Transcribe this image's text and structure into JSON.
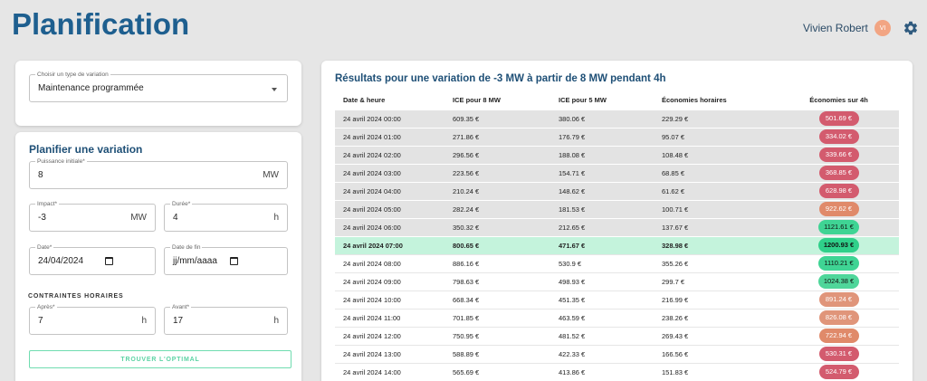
{
  "header": {
    "title": "Planification",
    "user_name": "Vivien Robert",
    "avatar_initials": "VI"
  },
  "variation_type": {
    "label": "Choisir un type de variation",
    "value": "Maintenance programmée"
  },
  "plan": {
    "title": "Planifier une variation",
    "puissance": {
      "label": "Puissance initiale*",
      "value": "8",
      "unit": "MW"
    },
    "impact": {
      "label": "Impact*",
      "value": "-3",
      "unit": "MW"
    },
    "duree": {
      "label": "Durée*",
      "value": "4",
      "unit": "h"
    },
    "date": {
      "label": "Date*",
      "value": "24/04/2024"
    },
    "date_fin": {
      "label": "Date de fin",
      "value": "jj/mm/aaaa"
    },
    "constraints_title": "CONTRAINTES HORAIRES",
    "apres": {
      "label": "Après*",
      "value": "7",
      "unit": "h"
    },
    "avant": {
      "label": "Avant*",
      "value": "17",
      "unit": "h"
    },
    "button_label": "TROUVER L'OPTIMAL"
  },
  "results": {
    "title": "Résultats pour une variation de -3 MW à partir de 8 MW pendant 4h",
    "columns": [
      "Date & heure",
      "ICE pour 8 MW",
      "ICE pour 5 MW",
      "Économies horaires",
      "Économies sur 4h"
    ],
    "rows": [
      {
        "date": "24 avril 2024 00:00",
        "ice8": "609.35 €",
        "ice5": "380.06 €",
        "eco_h": "229.29 €",
        "eco_4h": "501.69 €",
        "pill_color": "#d35b6e",
        "style": "shaded"
      },
      {
        "date": "24 avril 2024 01:00",
        "ice8": "271.86 €",
        "ice5": "176.79 €",
        "eco_h": "95.07 €",
        "eco_4h": "334.02 €",
        "pill_color": "#d35b6e",
        "style": "shaded"
      },
      {
        "date": "24 avril 2024 02:00",
        "ice8": "296.56 €",
        "ice5": "188.08 €",
        "eco_h": "108.48 €",
        "eco_4h": "339.66 €",
        "pill_color": "#d35b6e",
        "style": "shaded"
      },
      {
        "date": "24 avril 2024 03:00",
        "ice8": "223.56 €",
        "ice5": "154.71 €",
        "eco_h": "68.85 €",
        "eco_4h": "368.85 €",
        "pill_color": "#d35b6e",
        "style": "shaded"
      },
      {
        "date": "24 avril 2024 04:00",
        "ice8": "210.24 €",
        "ice5": "148.62 €",
        "eco_h": "61.62 €",
        "eco_4h": "628.98 €",
        "pill_color": "#d35b6e",
        "style": "shaded"
      },
      {
        "date": "24 avril 2024 05:00",
        "ice8": "282.24 €",
        "ice5": "181.53 €",
        "eco_h": "100.71 €",
        "eco_4h": "922.62 €",
        "pill_color": "#e08a6a",
        "style": "shaded"
      },
      {
        "date": "24 avril 2024 06:00",
        "ice8": "350.32 €",
        "ice5": "212.65 €",
        "eco_h": "137.67 €",
        "eco_4h": "1121.61 €",
        "pill_color": "#3fd494",
        "style": "shaded",
        "dark": true
      },
      {
        "date": "24 avril 2024 07:00",
        "ice8": "800.65 €",
        "ice5": "471.67 €",
        "eco_h": "328.98 €",
        "eco_4h": "1200.93 €",
        "pill_color": "#2fd08a",
        "style": "highlight",
        "dark": true
      },
      {
        "date": "24 avril 2024 08:00",
        "ice8": "886.16 €",
        "ice5": "530.9 €",
        "eco_h": "355.26 €",
        "eco_4h": "1110.21 €",
        "pill_color": "#3fd494",
        "style": "plain",
        "dark": true
      },
      {
        "date": "24 avril 2024 09:00",
        "ice8": "798.63 €",
        "ice5": "498.93 €",
        "eco_h": "299.7 €",
        "eco_4h": "1024.38 €",
        "pill_color": "#4fd69a",
        "style": "plain",
        "dark": true
      },
      {
        "date": "24 avril 2024 10:00",
        "ice8": "668.34 €",
        "ice5": "451.35 €",
        "eco_h": "216.99 €",
        "eco_4h": "891.24 €",
        "pill_color": "#e0957a",
        "style": "plain"
      },
      {
        "date": "24 avril 2024 11:00",
        "ice8": "701.85 €",
        "ice5": "463.59 €",
        "eco_h": "238.26 €",
        "eco_4h": "826.08 €",
        "pill_color": "#e0957a",
        "style": "plain"
      },
      {
        "date": "24 avril 2024 12:00",
        "ice8": "750.95 €",
        "ice5": "481.52 €",
        "eco_h": "269.43 €",
        "eco_4h": "722.94 €",
        "pill_color": "#e08a6a",
        "style": "plain"
      },
      {
        "date": "24 avril 2024 13:00",
        "ice8": "588.89 €",
        "ice5": "422.33 €",
        "eco_h": "166.56 €",
        "eco_4h": "530.31 €",
        "pill_color": "#d35b6e",
        "style": "plain"
      },
      {
        "date": "24 avril 2024 14:00",
        "ice8": "565.69 €",
        "ice5": "413.86 €",
        "eco_h": "151.83 €",
        "eco_4h": "524.79 €",
        "pill_color": "#d35b6e",
        "style": "plain"
      }
    ]
  },
  "colors": {
    "title_blue": "#1e5f8f",
    "highlight_green": "#c4f3dc",
    "button_green": "#5cd3a4",
    "avatar": "#f2a583"
  }
}
